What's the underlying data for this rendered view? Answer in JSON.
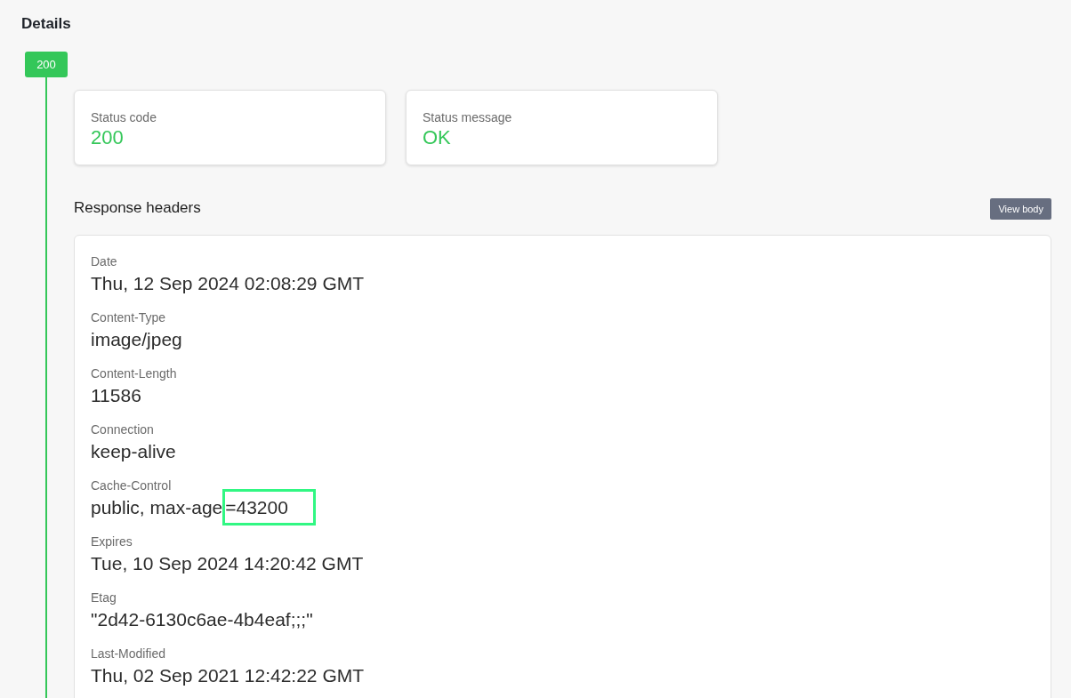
{
  "title": "Details",
  "timeline": {
    "badge": "200",
    "success": true
  },
  "status_cards": [
    {
      "label": "Status code",
      "value": "200"
    },
    {
      "label": "Status message",
      "value": "OK"
    }
  ],
  "response_headers": {
    "title": "Response headers",
    "button": "View body",
    "headers": [
      {
        "name": "Date",
        "value": "Thu, 12 Sep 2024 02:08:29 GMT"
      },
      {
        "name": "Content-Type",
        "value": "image/jpeg"
      },
      {
        "name": "Content-Length",
        "value": "11586"
      },
      {
        "name": "Connection",
        "value": "keep-alive"
      },
      {
        "name": "Cache-Control",
        "value_parts": [
          {
            "text": "public, max-age",
            "highlighted": false
          },
          {
            "text": "=43200",
            "highlighted": true
          }
        ]
      },
      {
        "name": "Expires",
        "value": "Tue, 10 Sep 2024 14:20:42 GMT"
      },
      {
        "name": "Etag",
        "value": "\"2d42-6130c6ae-4b4eaf;;;\""
      },
      {
        "name": "Last-Modified",
        "value": "Thu, 02 Sep 2021 12:42:22 GMT"
      }
    ]
  }
}
